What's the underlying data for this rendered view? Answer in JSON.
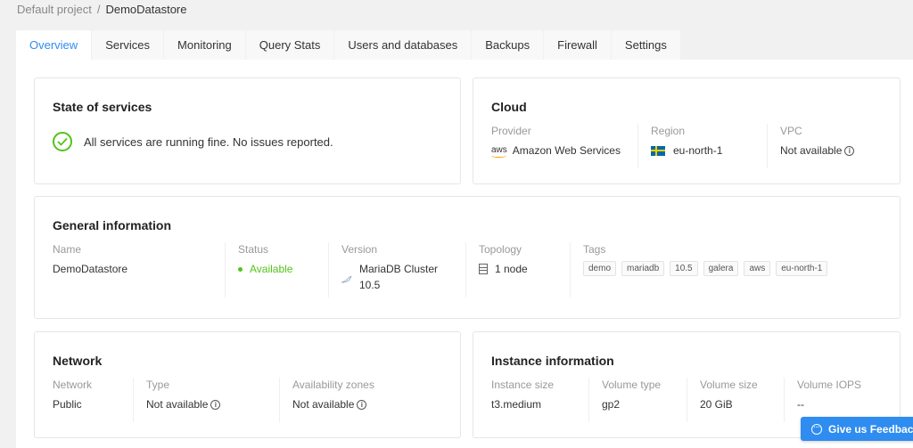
{
  "breadcrumb": {
    "project": "Default project",
    "separator": "/",
    "current": "DemoDatastore"
  },
  "tabs": [
    {
      "label": "Overview",
      "active": true
    },
    {
      "label": "Services",
      "active": false
    },
    {
      "label": "Monitoring",
      "active": false
    },
    {
      "label": "Query Stats",
      "active": false
    },
    {
      "label": "Users and databases",
      "active": false
    },
    {
      "label": "Backups",
      "active": false
    },
    {
      "label": "Firewall",
      "active": false
    },
    {
      "label": "Settings",
      "active": false
    }
  ],
  "state_of_services": {
    "title": "State of services",
    "message": "All services are running fine. No issues reported.",
    "icon": "check-circle-icon"
  },
  "cloud": {
    "title": "Cloud",
    "provider_label": "Provider",
    "provider_icon_text": "aws",
    "provider_value": "Amazon Web Services",
    "region_label": "Region",
    "region_value": "eu-north-1",
    "region_icon": "sweden-flag-icon",
    "vpc_label": "VPC",
    "vpc_value": "Not available",
    "info_glyph": "i"
  },
  "general": {
    "title": "General information",
    "name_label": "Name",
    "name_value": "DemoDatastore",
    "status_label": "Status",
    "status_value": "Available",
    "status_color": "#52c41a",
    "version_label": "Version",
    "version_line1": "MariaDB Cluster",
    "version_line2": "10.5",
    "topology_label": "Topology",
    "topology_value": "1 node",
    "tags_label": "Tags",
    "tags": [
      "demo",
      "mariadb",
      "10.5",
      "galera",
      "aws",
      "eu-north-1"
    ]
  },
  "network": {
    "title": "Network",
    "network_label": "Network",
    "network_value": "Public",
    "type_label": "Type",
    "type_value": "Not available",
    "zones_label": "Availability zones",
    "zones_value": "Not available",
    "info_glyph": "i"
  },
  "instance": {
    "title": "Instance information",
    "size_label": "Instance size",
    "size_value": "t3.medium",
    "vtype_label": "Volume type",
    "vtype_value": "gp2",
    "vsize_label": "Volume size",
    "vsize_value": "20 GiB",
    "iops_label": "Volume IOPS",
    "iops_value": "--"
  },
  "feedback": {
    "label": "Give us Feedback",
    "icon_glyph": "···"
  },
  "colors": {
    "accent": "#2f8cf0",
    "success": "#52c41a"
  }
}
